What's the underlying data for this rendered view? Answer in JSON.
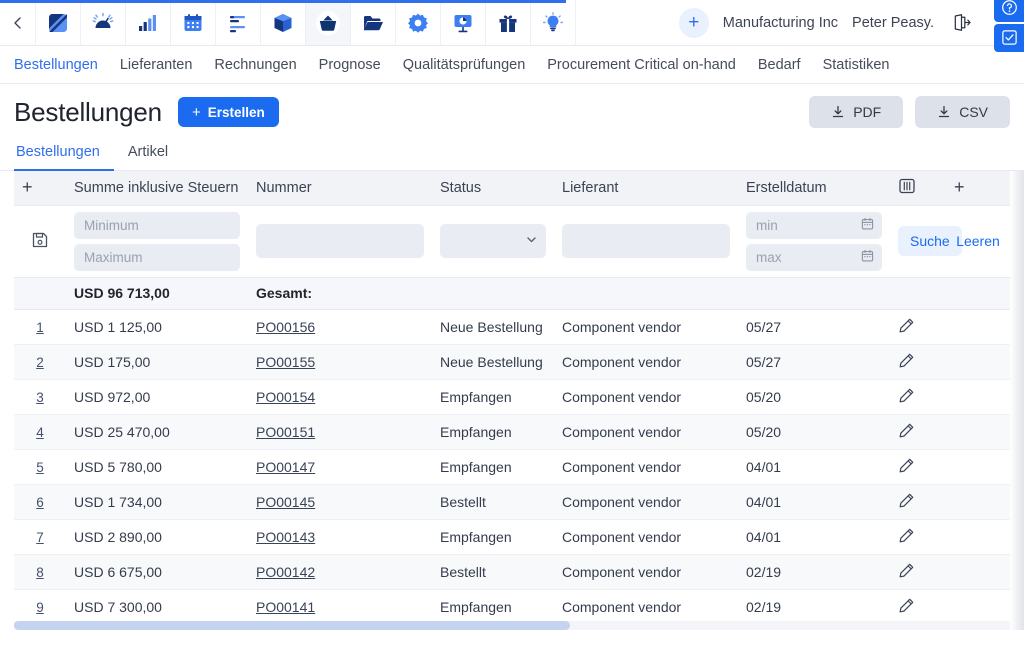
{
  "appbar": {
    "back_label": "‹",
    "icons": [
      {
        "name": "contrast-square-icon",
        "label": "Dashboard"
      },
      {
        "name": "gauge-icon",
        "label": "Kennzahlen"
      },
      {
        "name": "bar-chart-icon",
        "label": "Berichte"
      },
      {
        "name": "calendar-icon",
        "label": "Kalender"
      },
      {
        "name": "list-filter-icon",
        "label": "Aufgaben"
      },
      {
        "name": "cube-icon",
        "label": "Produkte"
      },
      {
        "name": "basket-icon",
        "label": "Einkauf"
      },
      {
        "name": "folder-icon",
        "label": "Dateien"
      },
      {
        "name": "gear-icon",
        "label": "Einstellungen"
      },
      {
        "name": "presentation-chart-icon",
        "label": "Analysen"
      },
      {
        "name": "gift-icon",
        "label": "Angebote"
      },
      {
        "name": "lightbulb-icon",
        "label": "Ideen"
      }
    ],
    "active_icon_index": 6,
    "plus_label": "+",
    "org_name": "Manufacturing Inc",
    "user_name": "Peter Peasy.",
    "logout_name": "logout-icon",
    "help_name": "help-icon",
    "check_name": "check-square-icon"
  },
  "section_nav": {
    "items": [
      {
        "label": "Bestellungen",
        "active": true
      },
      {
        "label": "Lieferanten",
        "active": false
      },
      {
        "label": "Rechnungen",
        "active": false
      },
      {
        "label": "Prognose",
        "active": false
      },
      {
        "label": "Qualitätsprüfungen",
        "active": false
      },
      {
        "label": "Procurement Critical on-hand",
        "active": false
      },
      {
        "label": "Bedarf",
        "active": false
      },
      {
        "label": "Statistiken",
        "active": false
      }
    ]
  },
  "page": {
    "title": "Bestellungen",
    "create_label": "Erstellen",
    "create_plus": "+",
    "pdf_label": "PDF",
    "csv_label": "CSV"
  },
  "subtabs": [
    {
      "label": "Bestellungen",
      "active": true
    },
    {
      "label": "Artikel",
      "active": false
    }
  ],
  "table": {
    "columns": {
      "index_plus": "+",
      "sum": "Summe inklusive Steuern",
      "number": "Nummer",
      "status": "Status",
      "supplier": "Lieferant",
      "created": "Erstelldatum",
      "columns_icon": "columns-icon",
      "add_plus": "+"
    },
    "filters": {
      "save_icon": "save-icon",
      "min_placeholder": "Minimum",
      "max_placeholder": "Maximum",
      "min_value": "",
      "max_value": "",
      "number_value": "",
      "status_value": "",
      "supplier_value": "",
      "date_min_placeholder": "min",
      "date_max_placeholder": "max",
      "date_min_value": "",
      "date_max_value": "",
      "search_label": "Suche",
      "clear_label": "Leeren"
    },
    "totals": {
      "amount": "USD 96 713,00",
      "label": "Gesamt:"
    },
    "rows": [
      {
        "idx": "1",
        "sum": "USD 1 125,00",
        "number": "PO00156",
        "status": "Neue Bestellung",
        "supplier": "Component vendor",
        "created": "05/27"
      },
      {
        "idx": "2",
        "sum": "USD 175,00",
        "number": "PO00155",
        "status": "Neue Bestellung",
        "supplier": "Component vendor",
        "created": "05/27"
      },
      {
        "idx": "3",
        "sum": "USD 972,00",
        "number": "PO00154",
        "status": "Empfangen",
        "supplier": "Component vendor",
        "created": "05/20"
      },
      {
        "idx": "4",
        "sum": "USD 25 470,00",
        "number": "PO00151",
        "status": "Empfangen",
        "supplier": "Component vendor",
        "created": "05/20"
      },
      {
        "idx": "5",
        "sum": "USD 5 780,00",
        "number": "PO00147",
        "status": "Empfangen",
        "supplier": "Component vendor",
        "created": "04/01"
      },
      {
        "idx": "6",
        "sum": "USD 1 734,00",
        "number": "PO00145",
        "status": "Bestellt",
        "supplier": "Component vendor",
        "created": "04/01"
      },
      {
        "idx": "7",
        "sum": "USD 2 890,00",
        "number": "PO00143",
        "status": "Empfangen",
        "supplier": "Component vendor",
        "created": "04/01"
      },
      {
        "idx": "8",
        "sum": "USD 6 675,00",
        "number": "PO00142",
        "status": "Bestellt",
        "supplier": "Component vendor",
        "created": "02/19"
      },
      {
        "idx": "9",
        "sum": "USD 7 300,00",
        "number": "PO00141",
        "status": "Empfangen",
        "supplier": "Component vendor",
        "created": "02/19"
      }
    ],
    "edit_icon": "pencil-icon"
  },
  "colors": {
    "accent": "#1a6bf0",
    "accent_light": "#e9f0fe",
    "header_bg": "#f1f3f7",
    "input_bg": "#e9ecf2",
    "text": "#343c4c"
  }
}
